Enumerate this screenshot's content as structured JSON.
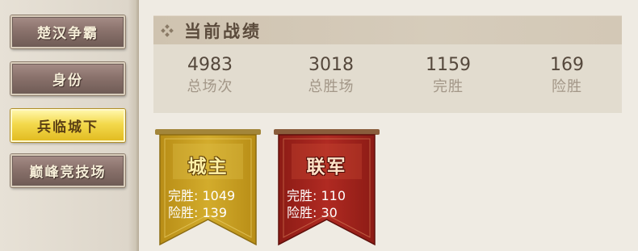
{
  "menu": {
    "items": [
      {
        "label": "楚汉争霸",
        "active": false
      },
      {
        "label": "身份",
        "active": false
      },
      {
        "label": "兵临城下",
        "active": true
      },
      {
        "label": "巅峰竞技场",
        "active": false
      }
    ]
  },
  "section": {
    "icon": "diamond-cluster-icon",
    "title": "当前战绩"
  },
  "stats": [
    {
      "value": "4983",
      "label": "总场次"
    },
    {
      "value": "3018",
      "label": "总胜场"
    },
    {
      "value": "1159",
      "label": "完胜"
    },
    {
      "value": "169",
      "label": "险胜"
    }
  ],
  "banners": [
    {
      "title": "城主",
      "color": "#c9a21f",
      "lines": [
        {
          "label": "完胜",
          "value": "1049",
          "text": "完胜: 1049"
        },
        {
          "label": "险胜",
          "value": "139",
          "text": "险胜: 139"
        }
      ]
    },
    {
      "title": "联军",
      "color": "#a9241d",
      "lines": [
        {
          "label": "完胜",
          "value": "110",
          "text": "完胜: 110"
        },
        {
          "label": "险胜",
          "value": "30",
          "text": "险胜: 30"
        }
      ]
    }
  ],
  "colors": {
    "active_menu": "#f3d94c",
    "menu": "#8a726c",
    "header_bg": "#d6ccbb",
    "stats_bg": "#e2dccf"
  }
}
